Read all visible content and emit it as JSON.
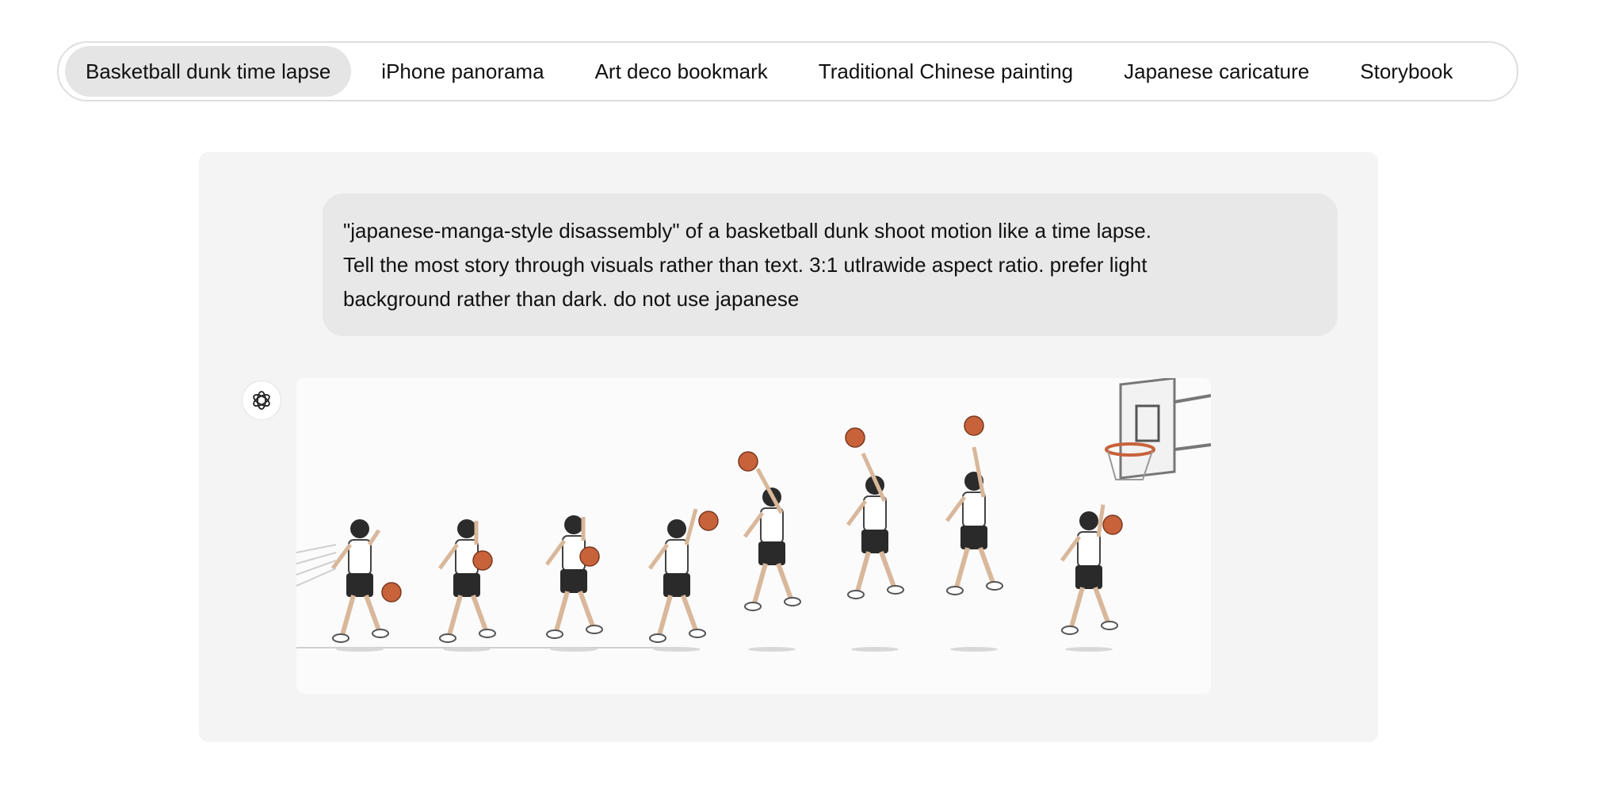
{
  "tabs": [
    {
      "label": "Basketball dunk time lapse",
      "active": true
    },
    {
      "label": "iPhone panorama",
      "active": false
    },
    {
      "label": "Art deco bookmark",
      "active": false
    },
    {
      "label": "Traditional Chinese painting",
      "active": false
    },
    {
      "label": "Japanese caricature",
      "active": false
    },
    {
      "label": "Storybook",
      "active": false
    }
  ],
  "conversation": {
    "prompt_lines": [
      "\"japanese-manga-style disassembly\" of a basketball dunk shoot motion like a time lapse.",
      "Tell the most story through visuals rather than text. 3:1 utlrawide aspect ratio. prefer light",
      "background rather than dark. do not use japanese"
    ],
    "assistant_icon": "openai-logo-icon",
    "generated_image": {
      "subject": "manga-style time lapse of a basketball dunk sequence",
      "figure_count": 8,
      "ball_color": "#c8623a",
      "background_color": "#fbfbfb"
    }
  },
  "colors": {
    "active_tab_bg": "#e5e5e5",
    "panel_bg": "#f4f4f4",
    "prompt_bg": "#e8e8e8"
  }
}
